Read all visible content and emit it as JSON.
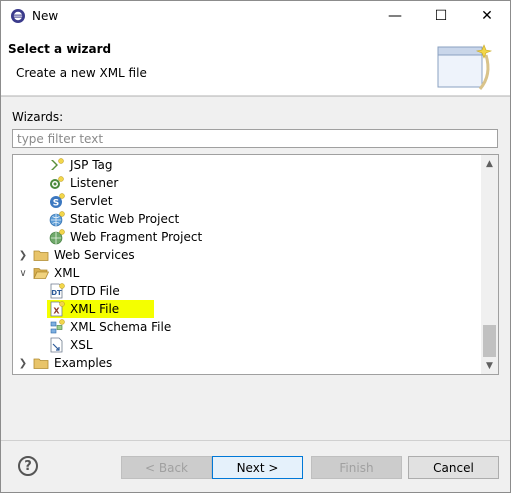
{
  "window": {
    "title": "New",
    "controls": {
      "minimize": "—",
      "maximize": "☐",
      "close": "✕"
    }
  },
  "banner": {
    "title": "Select a wizard",
    "description": "Create a new XML file"
  },
  "filter": {
    "label": "Wizards:",
    "placeholder": "type filter text",
    "value": ""
  },
  "tree": {
    "items": [
      {
        "label": "JSP Tag",
        "icon": "jsp-tag-icon",
        "expandable": false,
        "level": 2
      },
      {
        "label": "Listener",
        "icon": "listener-icon",
        "expandable": false,
        "level": 2
      },
      {
        "label": "Servlet",
        "icon": "servlet-icon",
        "expandable": false,
        "level": 2
      },
      {
        "label": "Static Web Project",
        "icon": "web-project-icon",
        "expandable": false,
        "level": 2
      },
      {
        "label": "Web Fragment Project",
        "icon": "web-fragment-icon",
        "expandable": false,
        "level": 2
      },
      {
        "label": "Web Services",
        "icon": "folder-icon",
        "expandable": true,
        "expanded": false,
        "level": 1
      },
      {
        "label": "XML",
        "icon": "folder-open-icon",
        "expandable": true,
        "expanded": true,
        "level": 1
      },
      {
        "label": "DTD File",
        "icon": "dtd-file-icon",
        "expandable": false,
        "level": 2
      },
      {
        "label": "XML File",
        "icon": "xml-file-icon",
        "expandable": false,
        "level": 2,
        "highlighted": true
      },
      {
        "label": "XML Schema File",
        "icon": "xml-schema-icon",
        "expandable": false,
        "level": 2
      },
      {
        "label": "XSL",
        "icon": "xsl-file-icon",
        "expandable": false,
        "level": 2
      },
      {
        "label": "Examples",
        "icon": "folder-icon",
        "expandable": true,
        "expanded": false,
        "level": 1
      }
    ]
  },
  "buttons": {
    "help": "?",
    "back": "< Back",
    "next": "Next >",
    "finish": "Finish",
    "cancel": "Cancel"
  },
  "colors": {
    "highlight": "#f4ff00",
    "accent": "#0078d7"
  }
}
